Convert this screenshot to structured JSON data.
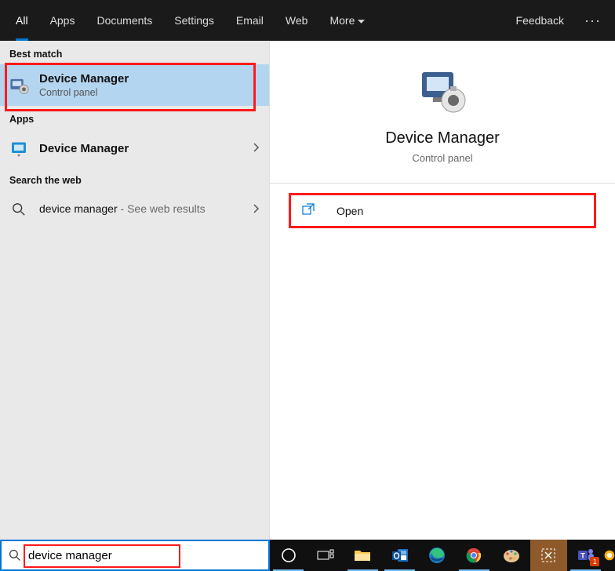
{
  "filters": {
    "items": [
      "All",
      "Apps",
      "Documents",
      "Settings",
      "Email",
      "Web",
      "More"
    ],
    "active_index": 0,
    "feedback": "Feedback"
  },
  "left": {
    "best_match_label": "Best match",
    "best_match": {
      "title": "Device Manager",
      "sub": "Control panel"
    },
    "apps_label": "Apps",
    "apps": [
      {
        "title": "Device Manager"
      }
    ],
    "search_web_label": "Search the web",
    "web_result": {
      "query": "device manager",
      "suffix": " - See web results"
    }
  },
  "detail": {
    "title": "Device Manager",
    "sub": "Control panel",
    "open_label": "Open"
  },
  "search": {
    "value": "device manager"
  },
  "taskbar": {
    "teams_badge": "1"
  }
}
